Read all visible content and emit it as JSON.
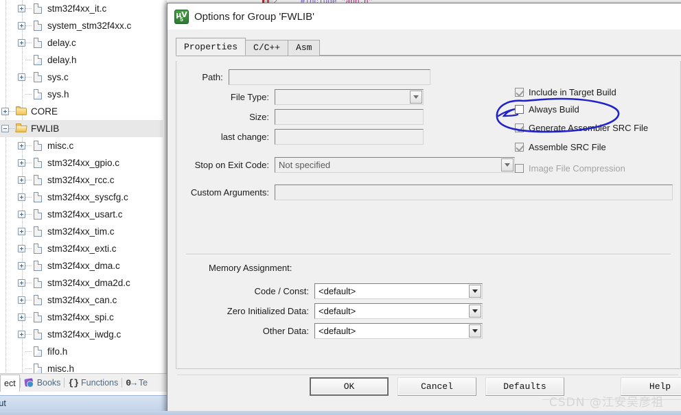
{
  "editor": {
    "line_number": "2",
    "code_include": "#include",
    "code_string": "\"app.h\""
  },
  "project_tree": {
    "items": [
      {
        "label": "stm32f4xx_it.c",
        "type": "file",
        "expander": "plus",
        "indent": 2,
        "selected": false
      },
      {
        "label": "system_stm32f4xx.c",
        "type": "file",
        "expander": "plus",
        "indent": 2,
        "selected": false
      },
      {
        "label": "delay.c",
        "type": "file",
        "expander": "plus",
        "indent": 2,
        "selected": false
      },
      {
        "label": "delay.h",
        "type": "file-h",
        "expander": "none",
        "indent": 2,
        "selected": false
      },
      {
        "label": "sys.c",
        "type": "file",
        "expander": "plus",
        "indent": 2,
        "selected": false
      },
      {
        "label": "sys.h",
        "type": "file-h",
        "expander": "none",
        "indent": 2,
        "selected": false
      },
      {
        "label": "CORE",
        "type": "folder",
        "expander": "plus",
        "indent": 1,
        "selected": false
      },
      {
        "label": "FWLIB",
        "type": "folder-open",
        "expander": "minus",
        "indent": 1,
        "selected": true
      },
      {
        "label": "misc.c",
        "type": "file",
        "expander": "plus",
        "indent": 2,
        "selected": false
      },
      {
        "label": "stm32f4xx_gpio.c",
        "type": "file",
        "expander": "plus",
        "indent": 2,
        "selected": false
      },
      {
        "label": "stm32f4xx_rcc.c",
        "type": "file",
        "expander": "plus",
        "indent": 2,
        "selected": false
      },
      {
        "label": "stm32f4xx_syscfg.c",
        "type": "file",
        "expander": "plus",
        "indent": 2,
        "selected": false
      },
      {
        "label": "stm32f4xx_usart.c",
        "type": "file",
        "expander": "plus",
        "indent": 2,
        "selected": false
      },
      {
        "label": "stm32f4xx_tim.c",
        "type": "file",
        "expander": "plus",
        "indent": 2,
        "selected": false
      },
      {
        "label": "stm32f4xx_exti.c",
        "type": "file",
        "expander": "plus",
        "indent": 2,
        "selected": false
      },
      {
        "label": "stm32f4xx_dma.c",
        "type": "file",
        "expander": "plus",
        "indent": 2,
        "selected": false
      },
      {
        "label": "stm32f4xx_dma2d.c",
        "type": "file",
        "expander": "plus",
        "indent": 2,
        "selected": false
      },
      {
        "label": "stm32f4xx_can.c",
        "type": "file",
        "expander": "plus",
        "indent": 2,
        "selected": false
      },
      {
        "label": "stm32f4xx_spi.c",
        "type": "file",
        "expander": "plus",
        "indent": 2,
        "selected": false
      },
      {
        "label": "stm32f4xx_iwdg.c",
        "type": "file",
        "expander": "plus",
        "indent": 2,
        "selected": false
      },
      {
        "label": "fifo.h",
        "type": "file-h",
        "expander": "none",
        "indent": 2,
        "selected": false
      },
      {
        "label": "misc.h",
        "type": "file-h",
        "expander": "none",
        "indent": 2,
        "selected": false
      }
    ]
  },
  "bottom_tabs": {
    "project": "ect",
    "books": "Books",
    "functions_icon": "{}",
    "functions": "Functions",
    "templates_icon": "0",
    "templates": "Te"
  },
  "output_pane": {
    "title": "tput"
  },
  "dialog": {
    "title": "Options for Group 'FWLIB'",
    "icon": "keil-uvision-icon",
    "icon_mu": "µV",
    "icon_v5": "5",
    "tabs": [
      {
        "label": "Properties",
        "active": true
      },
      {
        "label": "C/C++",
        "active": false
      },
      {
        "label": "Asm",
        "active": false
      }
    ],
    "fields": [
      {
        "label": "Path:",
        "value": "",
        "kind": "text",
        "enabled": false
      },
      {
        "label": "File Type:",
        "value": "",
        "kind": "combo",
        "enabled": false
      },
      {
        "label": "Size:",
        "value": "",
        "kind": "text",
        "enabled": false
      },
      {
        "label": "last change:",
        "value": "",
        "kind": "text",
        "enabled": false
      },
      {
        "label": "Stop on Exit Code:",
        "value": "Not specified",
        "kind": "combo",
        "enabled": false
      },
      {
        "label": "Custom Arguments:",
        "value": "",
        "kind": "text",
        "enabled": false
      }
    ],
    "checkboxes": [
      {
        "label": "Include in Target Build",
        "checked": true,
        "enabled": false
      },
      {
        "label": "Always Build",
        "checked": false,
        "enabled": true
      },
      {
        "label": "Generate Assembler SRC File",
        "checked": true,
        "enabled": false
      },
      {
        "label": "Assemble SRC File",
        "checked": true,
        "enabled": false
      },
      {
        "label": "Image File Compression",
        "checked": false,
        "enabled": false
      }
    ],
    "memory": {
      "title": "Memory Assignment:",
      "rows": [
        {
          "label": "Code / Const:",
          "value": "<default>"
        },
        {
          "label": "Zero Initialized Data:",
          "value": "<default>"
        },
        {
          "label": "Other Data:",
          "value": "<default>"
        }
      ]
    },
    "buttons": [
      {
        "label": "OK",
        "default": true
      },
      {
        "label": "Cancel",
        "default": false
      },
      {
        "label": "Defaults",
        "default": false
      },
      {
        "label": "Help",
        "default": false
      }
    ]
  },
  "annotation": {
    "type": "hand-drawn-ellipse",
    "color": "#2222cc",
    "target": "Always Build"
  },
  "watermark": {
    "text": "CSDN @江安吴彦祖"
  },
  "colors": {
    "dialog_bg": "#f0f0f0",
    "selection": "#e8e8e8",
    "annotation_blue": "#2222cc",
    "output_header": "#c3d4ea"
  }
}
